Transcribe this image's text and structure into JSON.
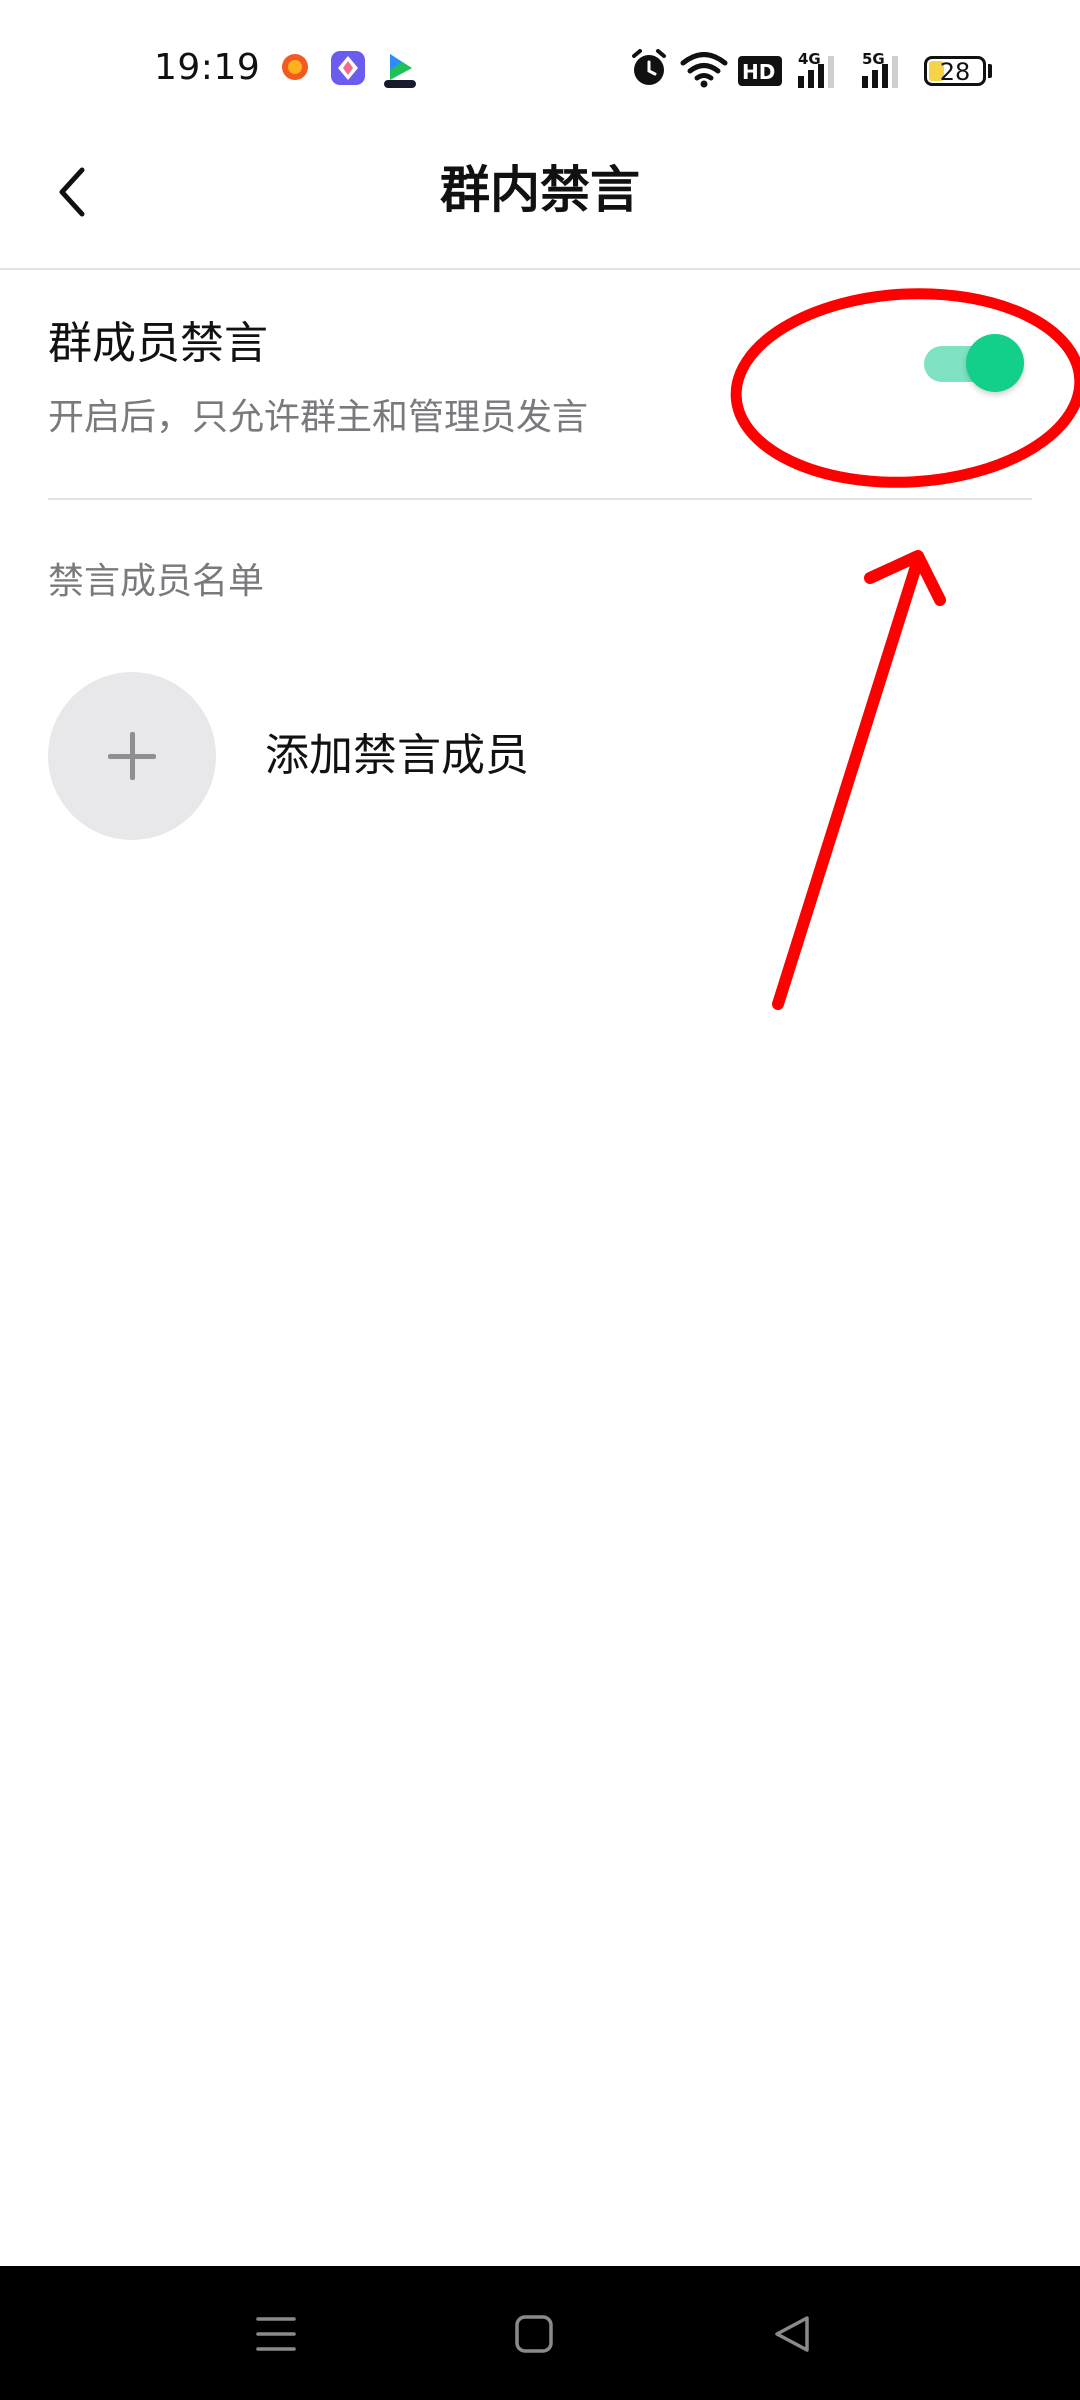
{
  "status_bar": {
    "time": "19:19",
    "app_icons": [
      "taobao-icon",
      "pinwheel-app-icon",
      "video-app-icon"
    ],
    "right_icons": [
      "alarm-icon",
      "wifi-icon",
      "hd-icon",
      "signal-4g-icon",
      "signal-5g-icon"
    ],
    "hd_label": "HD",
    "signal_4g_label": "4G",
    "signal_5g_label": "5G",
    "battery_level": "28",
    "battery_fraction": 0.28
  },
  "nav": {
    "title": "群内禁言",
    "back_icon": "chevron-left-icon"
  },
  "mute_all": {
    "title": "群成员禁言",
    "description": "开启后，只允许群主和管理员发言",
    "enabled": true,
    "toggle_color": "#12d08a"
  },
  "muted_list": {
    "header": "禁言成员名单",
    "add_label": "添加禁言成员",
    "add_icon": "plus-icon"
  },
  "annotation": {
    "color": "#ff0000",
    "shapes": [
      "ellipse-circle",
      "arrow"
    ]
  },
  "system_nav": {
    "buttons": [
      "menu-icon",
      "home-icon",
      "back-triangle-icon"
    ]
  }
}
